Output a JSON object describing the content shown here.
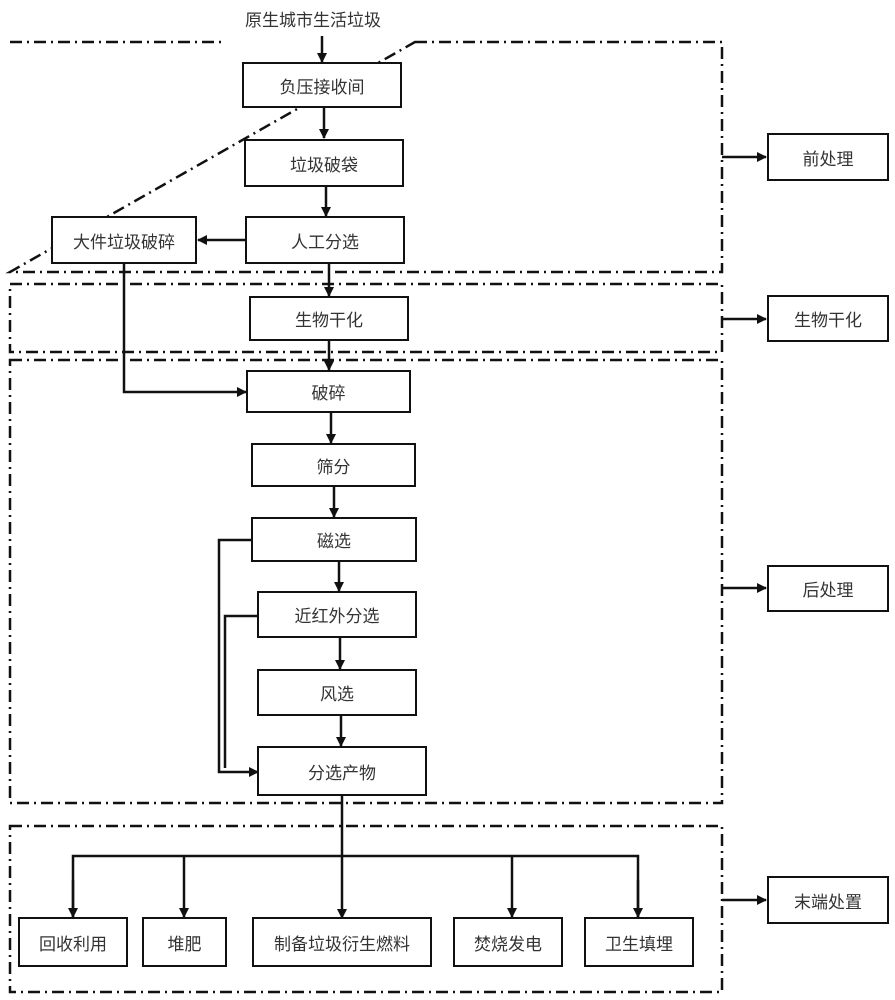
{
  "diagram": {
    "input_label": "原生城市生活垃圾",
    "stages": {
      "pre": "前处理",
      "bio": "生物干化",
      "post": "后处理",
      "end": "末端处置"
    },
    "nodes": {
      "negative_pressure": "负压接收间",
      "bag_breaking": "垃圾破袋",
      "manual_sorting": "人工分选",
      "bulky_crushing": "大件垃圾破碎",
      "bio_drying": "生物干化",
      "crushing": "破碎",
      "screening": "筛分",
      "magnetic": "磁选",
      "nir_sorting": "近红外分选",
      "air_sorting": "风选",
      "sorted_products": "分选产物"
    },
    "outputs": [
      "回收利用",
      "堆肥",
      "制备垃圾衍生燃料",
      "焚烧发电",
      "卫生填埋"
    ]
  }
}
